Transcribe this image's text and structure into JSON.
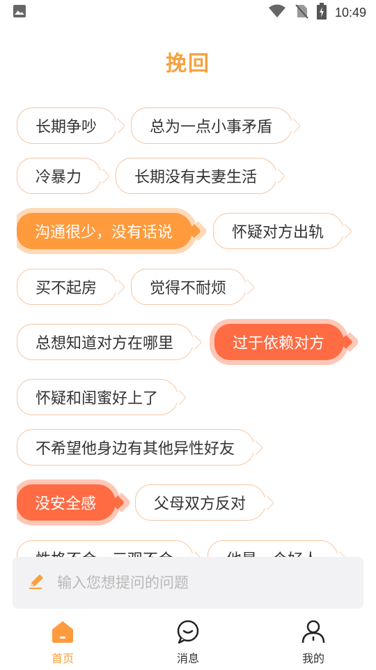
{
  "status_bar": {
    "time": "10:49"
  },
  "header": {
    "title": "挽回"
  },
  "tags": [
    {
      "label": "长期争吵",
      "state": "normal"
    },
    {
      "label": "总为一点小事矛盾",
      "state": "normal"
    },
    {
      "label": "冷暴力",
      "state": "normal"
    },
    {
      "label": "长期没有夫妻生活",
      "state": "normal"
    },
    {
      "label": "沟通很少，没有话说",
      "state": "selected-orange"
    },
    {
      "label": "怀疑对方出轨",
      "state": "normal"
    },
    {
      "label": "买不起房",
      "state": "normal"
    },
    {
      "label": "觉得不耐烦",
      "state": "normal"
    },
    {
      "label": "总想知道对方在哪里",
      "state": "normal"
    },
    {
      "label": "过于依赖对方",
      "state": "selected-red"
    },
    {
      "label": "怀疑和闺蜜好上了",
      "state": "normal"
    },
    {
      "label": "不希望他身边有其他异性好友",
      "state": "normal"
    },
    {
      "label": "没安全感",
      "state": "selected-red"
    },
    {
      "label": "父母双方反对",
      "state": "normal"
    },
    {
      "label": "性格不合，三观不合",
      "state": "normal"
    },
    {
      "label": "他是一个好人",
      "state": "normal"
    }
  ],
  "ask": {
    "placeholder": "输入您想提问的问题",
    "icon": "pencil-icon"
  },
  "tabbar": {
    "items": [
      {
        "label": "首页",
        "icon": "home-icon",
        "active": true
      },
      {
        "label": "消息",
        "icon": "message-icon",
        "active": false
      },
      {
        "label": "我的",
        "icon": "profile-icon",
        "active": false
      }
    ]
  },
  "colors": {
    "accent": "#f7a03c",
    "selected_orange": "#ff9a3d",
    "selected_red": "#ff6c44",
    "tag_border": "#f6c6a2"
  }
}
